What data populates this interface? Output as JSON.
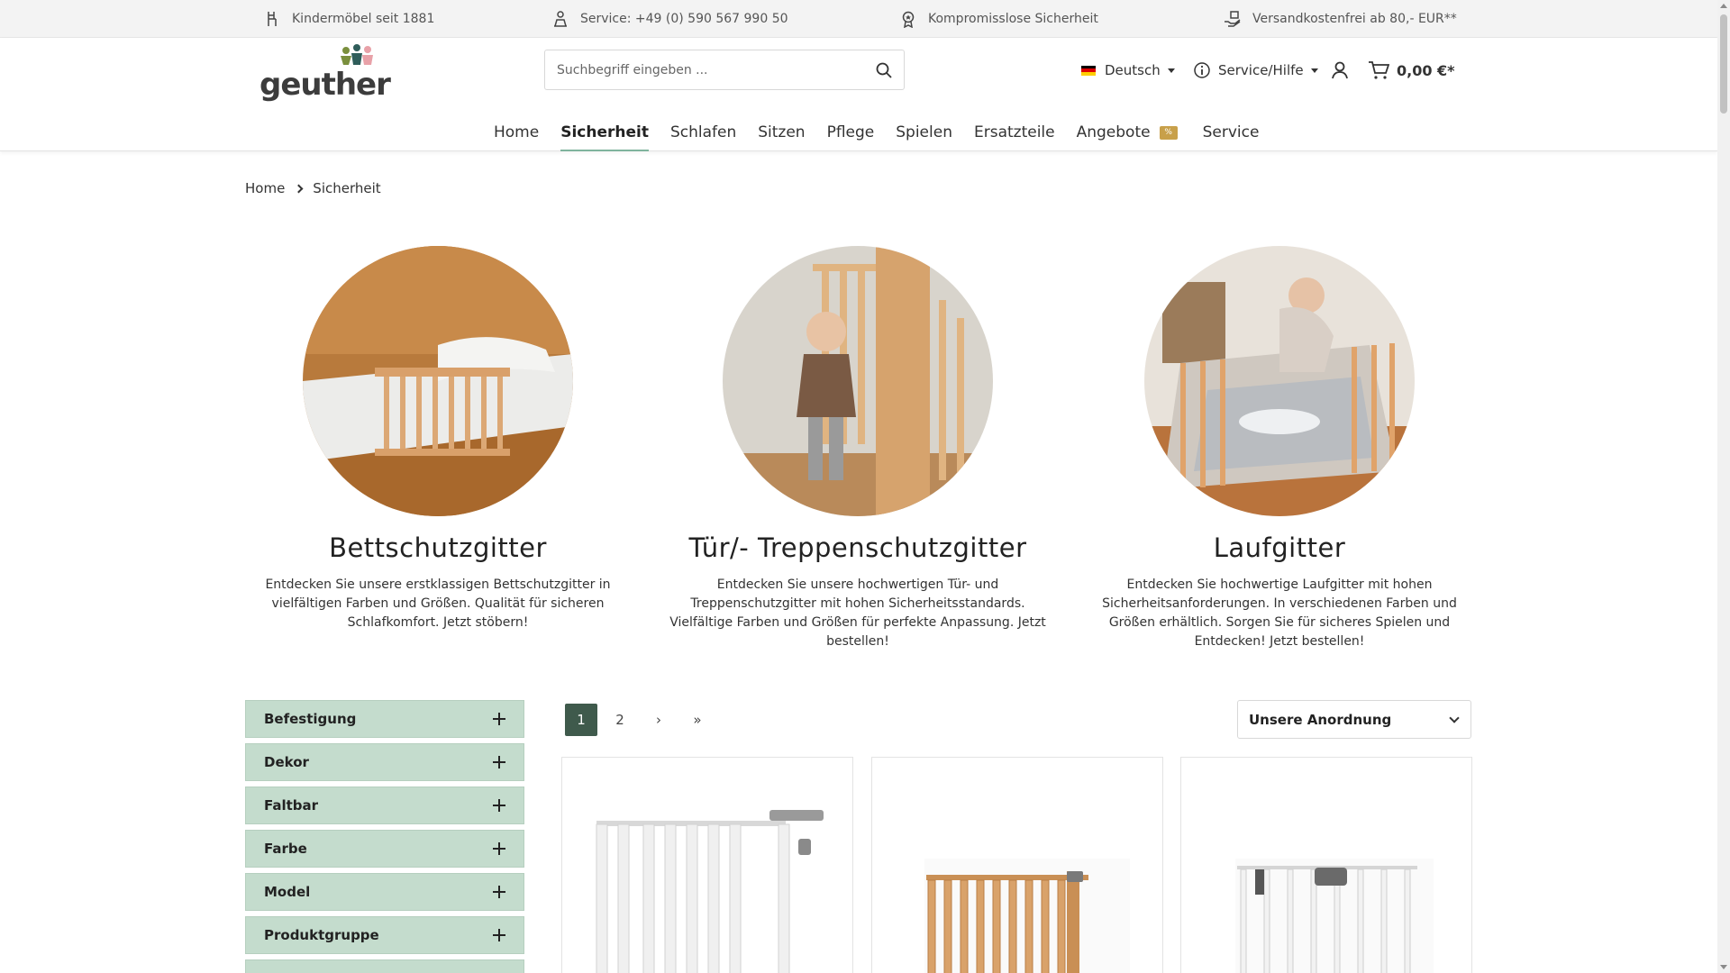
{
  "topbar": {
    "items": [
      {
        "label": "Kindermöbel seit 1881",
        "icon": "chair-icon"
      },
      {
        "label": "Service: +49 (0) 590 567 990 50",
        "icon": "support-agent-icon"
      },
      {
        "label": "Kompromisslose Sicherheit",
        "icon": "award-icon"
      },
      {
        "label": "Versandkostenfrei ab 80,- EUR**",
        "icon": "hand-package-icon"
      }
    ]
  },
  "header": {
    "logo_text": "geuther",
    "search_placeholder": "Suchbegriff eingeben ...",
    "language": "Deutsch",
    "help_label": "Service/Hilfe",
    "cart_total": "0,00 €*"
  },
  "nav": {
    "items": [
      "Home",
      "Sicherheit",
      "Schlafen",
      "Sitzen",
      "Pflege",
      "Spielen",
      "Ersatzteile",
      "Angebote",
      "Service"
    ],
    "active": "Sicherheit",
    "offer_badge": "%"
  },
  "breadcrumb": [
    "Home",
    "Sicherheit"
  ],
  "categories": [
    {
      "title": "Bettschutzgitter",
      "text": "Entdecken Sie unsere erstklassigen Bettschutzgitter in vielfältigen Farben und Größen. Qualität für sicheren Schlafkomfort. Jetzt stöbern!"
    },
    {
      "title": "Tür/- Treppenschutzgitter",
      "text": "Entdecken Sie unsere hochwertigen Tür- und Treppenschutzgitter mit hohen Sicherheitsstandards. Vielfältige Farben und Größen für perfekte Anpassung. Jetzt bestellen!"
    },
    {
      "title": "Laufgitter",
      "text": "Entdecken Sie hochwertige Laufgitter mit hohen Sicherheitsanforderungen. In verschiedenen Farben und Größen erhältlich. Sorgen Sie für sicheres Spielen und Entdecken! Jetzt bestellen!"
    }
  ],
  "filters": [
    "Befestigung",
    "Dekor",
    "Faltbar",
    "Farbe",
    "Model",
    "Produktgruppe"
  ],
  "pagination": {
    "pages": [
      "1",
      "2"
    ],
    "current": "1",
    "next": "›",
    "last": "»"
  },
  "sort": {
    "selected": "Unsere Anordnung"
  },
  "colors": {
    "accent_green": "#c4dccd",
    "pager_active": "#3f5a4c",
    "nav_underline": "#7fb39d",
    "badge": "#c8a04a"
  }
}
